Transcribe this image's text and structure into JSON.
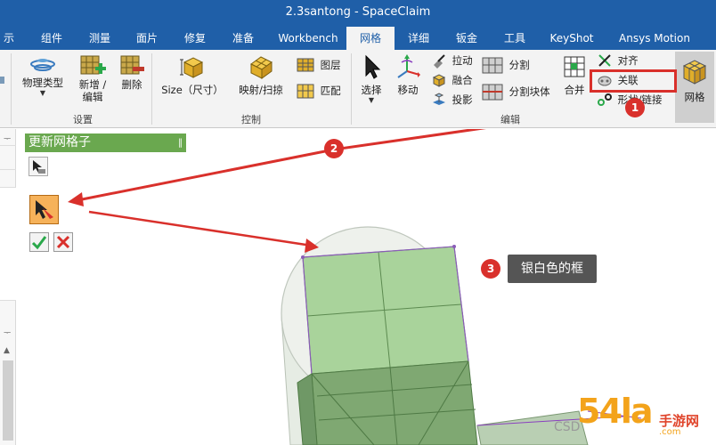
{
  "window": {
    "title": "2.3santong - SpaceClaim"
  },
  "tabs": [
    {
      "label": "示"
    },
    {
      "label": "组件"
    },
    {
      "label": "测量"
    },
    {
      "label": "面片"
    },
    {
      "label": "修复"
    },
    {
      "label": "准备"
    },
    {
      "label": "Workbench"
    },
    {
      "label": "网格",
      "active": true
    },
    {
      "label": "详细"
    },
    {
      "label": "钣金"
    },
    {
      "label": "工具"
    },
    {
      "label": "KeyShot"
    },
    {
      "label": "Ansys Motion"
    }
  ],
  "ribbon": {
    "groups": {
      "settings": "设置",
      "control": "控制",
      "edit": "编辑"
    },
    "buttons": {
      "physics_type": "物理类型",
      "add_edit_line1": "新增 /",
      "add_edit_line2": "编辑",
      "delete": "删除",
      "size": "Size（尺寸）",
      "map_sweep": "映射/扫掠",
      "layer": "图层",
      "match": "匹配",
      "select": "选择",
      "move": "移动",
      "pull": "拉动",
      "fuse": "融合",
      "project": "投影",
      "split": "分割",
      "split_block": "分割块体",
      "merge": "合并",
      "align": "对齐",
      "associate": "关联",
      "shape_link": "形状/链接",
      "mesh": "网格"
    }
  },
  "tool_panel": {
    "title": "更新网格子",
    "pin_glyph": "‖"
  },
  "annotations": {
    "badge1": "1",
    "badge2": "2",
    "badge3": "3",
    "callout3": "银白色的框"
  },
  "watermark": {
    "main": "54la",
    "sub": "手游网",
    "site": ".com",
    "csdn": "CSD"
  },
  "colors": {
    "titlebar": "#1f5fa8",
    "annotation_red": "#d9302b",
    "tool_header": "#6aa84f",
    "mesh_green": "#9fcc8f"
  }
}
